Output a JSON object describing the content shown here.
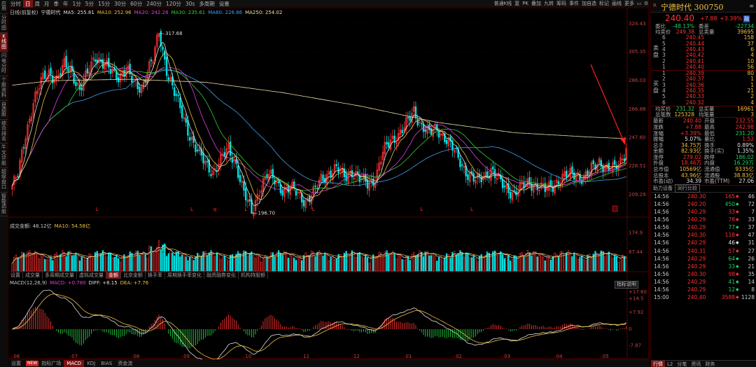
{
  "colors": {
    "up": "#ff3030",
    "down": "#00e0e0",
    "ma5": "#e0e0e0",
    "ma10": "#f0c040",
    "ma20": "#e040e0",
    "ma30": "#30d030",
    "ma60": "#40a0f0",
    "ma250": "#e8e0a0",
    "vol_ma5": "#e0e0e0",
    "vol_ma10": "#f0c040",
    "macd_diff": "#e0e0e0",
    "macd_dea": "#f0c040",
    "arrow": "#ff2020"
  },
  "left_sidebar": [
    "应用",
    "分时图",
    "K线图",
    "闪电分时",
    "个股资料",
    "自选股",
    "综合排名",
    "牛叉诊股",
    "超级盘口",
    "智能选股"
  ],
  "toolbar": {
    "periods": [
      "分时",
      "日",
      "周",
      "月",
      "季",
      "年",
      "1分",
      "5分",
      "15分",
      "30分",
      "60分",
      "240分",
      "120分",
      "30s",
      "多周期",
      "设置"
    ],
    "active_period": "日",
    "tools": [
      "普通K线",
      "复",
      "PK",
      "叠加",
      "九转",
      "筹码",
      "事件",
      "加自选",
      "标记",
      "画线",
      "更多"
    ]
  },
  "main_legend": [
    {
      "label": "日线(前复权)",
      "color": "#c8c8c8"
    },
    {
      "label": "宁德时代",
      "color": "#e0e0e0"
    },
    {
      "label": "MA5: 255.81",
      "color": "#e0e0e0"
    },
    {
      "label": "MA10: 252.96",
      "color": "#f0c040"
    },
    {
      "label": "MA20: 242.28",
      "color": "#e040e0"
    },
    {
      "label": "MA30: 235.61",
      "color": "#30d030"
    },
    {
      "label": "MA60: 226.86",
      "color": "#40a0f0"
    },
    {
      "label": "MA250: 254.02",
      "color": "#e8e0a0"
    }
  ],
  "price_axis": [
    "324.43",
    "305.35",
    "286.03",
    "266.88",
    "247.60",
    "228.51",
    "209.29"
  ],
  "annotations": {
    "high": "317.68",
    "low": "196.70",
    "marker": "L",
    "marker_q": "q"
  },
  "volume_legend": [
    {
      "label": "成交金额: 48.12亿",
      "color": "#c8c8c8"
    },
    {
      "label": "MA10: 54.58亿",
      "color": "#f0c040"
    }
  ],
  "volume_axis": [
    "174.9",
    "87.44"
  ],
  "indicator_tabs": [
    "设置",
    "成交量",
    "多周期成交量",
    "虚拟成交量",
    "金额",
    "北京金额",
    "换手率",
    "周期换手率变化",
    "融资融券变化",
    "机构持股额"
  ],
  "active_indicator": "金额",
  "macd_legend": [
    {
      "label": "MACD(12,26,9)",
      "color": "#c8c8c8"
    },
    {
      "label": "MACD: +0.780",
      "color": "#e040e0"
    },
    {
      "label": "DIFF: +8.15",
      "color": "#e0e0e0"
    },
    {
      "label": "DEA: +7.76",
      "color": "#f0c040"
    }
  ],
  "macd_axis": [
    "+17.60",
    "+14.5",
    "+7.92",
    "0",
    "-7.87"
  ],
  "indicator_explain": "指标说明",
  "x_axis_months": [
    "06",
    "07",
    "08",
    "09",
    "10",
    "11",
    "12",
    "01",
    "02",
    "03",
    "04",
    "05"
  ],
  "bottom_tabs": [
    "设置",
    "指标广场",
    "MACD",
    "KDJ",
    "BIAS",
    "资金流"
  ],
  "bottom_active": "MACD",
  "bottom_badge": "NEW",
  "quote": {
    "stock_title": "宁德时代 300750",
    "market_badge": "R",
    "price": "240.40",
    "change": "+7.88",
    "change_pct": "+3.39%",
    "tag": "融",
    "weibi": {
      "label": "委比",
      "value": "-48.13%",
      "label2": "委差",
      "value2": "-22734"
    },
    "avg": {
      "label": "均卖价",
      "value": "249.38",
      "label2": "总卖量",
      "value2": "39695"
    },
    "asks": [
      {
        "lvl": "6",
        "price": "240.45",
        "vol": "158"
      },
      {
        "lvl": "5",
        "price": "240.44",
        "vol": "37"
      },
      {
        "lvl": "4",
        "price": "240.43",
        "vol": "6"
      },
      {
        "lvl": "3",
        "price": "240.42",
        "vol": "4"
      },
      {
        "lvl": "2",
        "price": "240.41",
        "vol": "10"
      },
      {
        "lvl": "1",
        "price": "240.40",
        "vol": "56"
      }
    ],
    "ask_side": "卖盘",
    "bids": [
      {
        "lvl": "1",
        "price": "240.39",
        "vol": "80"
      },
      {
        "lvl": "2",
        "price": "240.37",
        "vol": "1"
      },
      {
        "lvl": "3",
        "price": "240.36",
        "vol": "1"
      },
      {
        "lvl": "4",
        "price": "240.35",
        "vol": "21"
      },
      {
        "lvl": "5",
        "price": "240.33",
        "vol": "2"
      },
      {
        "lvl": "6",
        "price": "240.32",
        "vol": "4"
      }
    ],
    "bid_side": "买盘",
    "bid_summary": {
      "label": "均买价",
      "value": "231.32",
      "label2": "总买量",
      "value2": "16961"
    },
    "bid_summary2": {
      "label": "总笔数",
      "value": "125328",
      "label2": "均笔量",
      "value2": "3"
    },
    "stats": [
      {
        "l": "最新",
        "lv": "240.40",
        "lc": "red",
        "r": "开盘",
        "rv": "232.55",
        "rc": "red"
      },
      {
        "l": "涨跌",
        "lv": "+7.88",
        "lc": "red",
        "r": "最高",
        "rv": "242.98",
        "rc": "red"
      },
      {
        "l": "涨幅",
        "lv": "+3.39%",
        "lc": "red",
        "r": "最低",
        "rv": "231.20",
        "rc": "green"
      },
      {
        "l": "振幅",
        "lv": "5.07%",
        "lc": "white",
        "r": "量比",
        "rv": "1.52",
        "rc": "red"
      },
      {
        "l": "总手",
        "lv": "34.75万",
        "lc": "yellow",
        "r": "换手",
        "rv": "0.89%",
        "rc": "white"
      },
      {
        "l": "金额",
        "lv": "82.93亿",
        "lc": "yellow",
        "r": "换手(实)",
        "rv": "1.35%",
        "rc": "white"
      },
      {
        "l": "涨停",
        "lv": "279.02",
        "lc": "red",
        "r": "跌停",
        "rv": "186.02",
        "rc": "green"
      },
      {
        "l": "外盘",
        "lv": "18.46万",
        "lc": "red",
        "r": "内盘",
        "rv": "16.29万",
        "rc": "green"
      },
      {
        "l": "总市值",
        "lv": "10569亿",
        "lc": "yellow",
        "r": "流通值",
        "rv": "9335亿",
        "rc": "yellow"
      },
      {
        "l": "总股本",
        "lv": "43.96亿",
        "lc": "yellow",
        "r": "流通股",
        "rv": "38.83亿",
        "rc": "yellow"
      },
      {
        "l": "市盈(动)",
        "lv": "34.39",
        "lc": "white",
        "r": "市盈(TTM)",
        "rv": "27.06",
        "rc": "white"
      }
    ],
    "trades_tabs": [
      "助力设备",
      "同行比较"
    ],
    "trades": [
      {
        "time": "14:56",
        "price": "240.30",
        "vol": "165",
        "dir": "◆",
        "dc": "red",
        "cnt": "46"
      },
      {
        "time": "14:56",
        "price": "240.20",
        "vol": "450",
        "dir": "◆",
        "dc": "green",
        "cnt": "72"
      },
      {
        "time": "14:56",
        "price": "240.29",
        "vol": "33",
        "dir": "◆",
        "dc": "red",
        "cnt": "7"
      },
      {
        "time": "14:56",
        "price": "240.29",
        "vol": "78",
        "dir": "◆",
        "dc": "red",
        "cnt": "33"
      },
      {
        "time": "14:56",
        "price": "240.29",
        "vol": "77",
        "dir": "◆",
        "dc": "green",
        "cnt": "37"
      },
      {
        "time": "14:56",
        "price": "240.30",
        "vol": "118",
        "dir": "◆",
        "dc": "red",
        "cnt": "47"
      },
      {
        "time": "14:56",
        "price": "240.29",
        "vol": "46",
        "dir": "◆",
        "dc": "white",
        "cnt": "31"
      },
      {
        "time": "14:56",
        "price": "240.31",
        "vol": "57",
        "dir": "◆",
        "dc": "red",
        "cnt": "27"
      },
      {
        "time": "14:56",
        "price": "240.29",
        "vol": "64",
        "dir": "◆",
        "dc": "green",
        "cnt": "26"
      },
      {
        "time": "14:56",
        "price": "240.29",
        "vol": "33",
        "dir": "◆",
        "dc": "green",
        "cnt": "21"
      },
      {
        "time": "14:56",
        "price": "240.30",
        "vol": "98",
        "dir": "◆",
        "dc": "red",
        "cnt": "35"
      },
      {
        "time": "14:56",
        "price": "240.29",
        "vol": "41",
        "dir": "◆",
        "dc": "green",
        "cnt": "14"
      },
      {
        "time": "14:56",
        "price": "240.29",
        "vol": "12",
        "dir": "◆",
        "dc": "green",
        "cnt": "8"
      },
      {
        "time": "15:00",
        "price": "240.40",
        "vol": "3588",
        "dir": "◆",
        "dc": "red",
        "cnt": "1128"
      }
    ],
    "bottom_tabs": [
      "行情",
      "L2",
      "分笔",
      "资讯",
      "财务"
    ],
    "bottom_active": "行情"
  },
  "chart_data": [
    {
      "type": "candlestick",
      "title": "宁德时代",
      "x_ticks": [
        "06",
        "07",
        "08",
        "09",
        "10",
        "11",
        "12",
        "01",
        "02",
        "03",
        "04",
        "05"
      ],
      "y_ticks": [
        324.43,
        305.35,
        286.03,
        266.88,
        247.6,
        228.51,
        209.29
      ],
      "ylim": [
        196,
        330
      ],
      "close_waypoints": [
        [
          0,
          215
        ],
        [
          3,
          222
        ],
        [
          7,
          250
        ],
        [
          11,
          272
        ],
        [
          15,
          285
        ],
        [
          19,
          292
        ],
        [
          23,
          287
        ],
        [
          27,
          296
        ],
        [
          31,
          292
        ],
        [
          35,
          280
        ],
        [
          39,
          290
        ],
        [
          43,
          303
        ],
        [
          47,
          298
        ],
        [
          51,
          292
        ],
        [
          55,
          289
        ],
        [
          59,
          295
        ],
        [
          63,
          283
        ],
        [
          67,
          281
        ],
        [
          70,
          294
        ],
        [
          73,
          300
        ],
        [
          76,
          318
        ],
        [
          80,
          294
        ],
        [
          84,
          278
        ],
        [
          88,
          263
        ],
        [
          92,
          250
        ],
        [
          96,
          238
        ],
        [
          100,
          230
        ],
        [
          104,
          225
        ],
        [
          108,
          232
        ],
        [
          112,
          240
        ],
        [
          116,
          230
        ],
        [
          120,
          210
        ],
        [
          124,
          197
        ],
        [
          128,
          213
        ],
        [
          132,
          222
        ],
        [
          136,
          219
        ],
        [
          140,
          213
        ],
        [
          144,
          213
        ],
        [
          148,
          210
        ],
        [
          152,
          205
        ],
        [
          156,
          210
        ],
        [
          160,
          220
        ],
        [
          164,
          224
        ],
        [
          168,
          226
        ],
        [
          172,
          222
        ],
        [
          176,
          225
        ],
        [
          180,
          219
        ],
        [
          184,
          217
        ],
        [
          188,
          220
        ],
        [
          192,
          237
        ],
        [
          196,
          246
        ],
        [
          200,
          250
        ],
        [
          204,
          256
        ],
        [
          208,
          266
        ],
        [
          212,
          256
        ],
        [
          216,
          250
        ],
        [
          220,
          254
        ],
        [
          224,
          248
        ],
        [
          228,
          240
        ],
        [
          232,
          232
        ],
        [
          236,
          223
        ],
        [
          240,
          218
        ],
        [
          244,
          222
        ],
        [
          248,
          226
        ],
        [
          252,
          218
        ],
        [
          256,
          214
        ],
        [
          260,
          210
        ],
        [
          264,
          214
        ],
        [
          268,
          218
        ],
        [
          272,
          215
        ],
        [
          276,
          212
        ],
        [
          280,
          216
        ],
        [
          284,
          220
        ],
        [
          288,
          222
        ],
        [
          292,
          224
        ],
        [
          296,
          220
        ],
        [
          300,
          226
        ],
        [
          304,
          232
        ],
        [
          308,
          227
        ],
        [
          312,
          226
        ],
        [
          315,
          232
        ],
        [
          318,
          240.4
        ]
      ],
      "ma250_waypoints": [
        [
          0,
          283
        ],
        [
          20,
          286
        ],
        [
          60,
          287
        ],
        [
          100,
          285
        ],
        [
          140,
          278
        ],
        [
          180,
          269
        ],
        [
          220,
          258
        ],
        [
          260,
          251
        ],
        [
          300,
          248
        ],
        [
          318,
          247
        ]
      ],
      "volume_axis": [
        174.9,
        87.44
      ],
      "macd_axis": [
        17.6,
        14.5,
        7.92,
        0,
        -7.87
      ],
      "annotations": [
        {
          "label": "317.68",
          "type": "high"
        },
        {
          "label": "196.70",
          "type": "low"
        }
      ]
    }
  ]
}
